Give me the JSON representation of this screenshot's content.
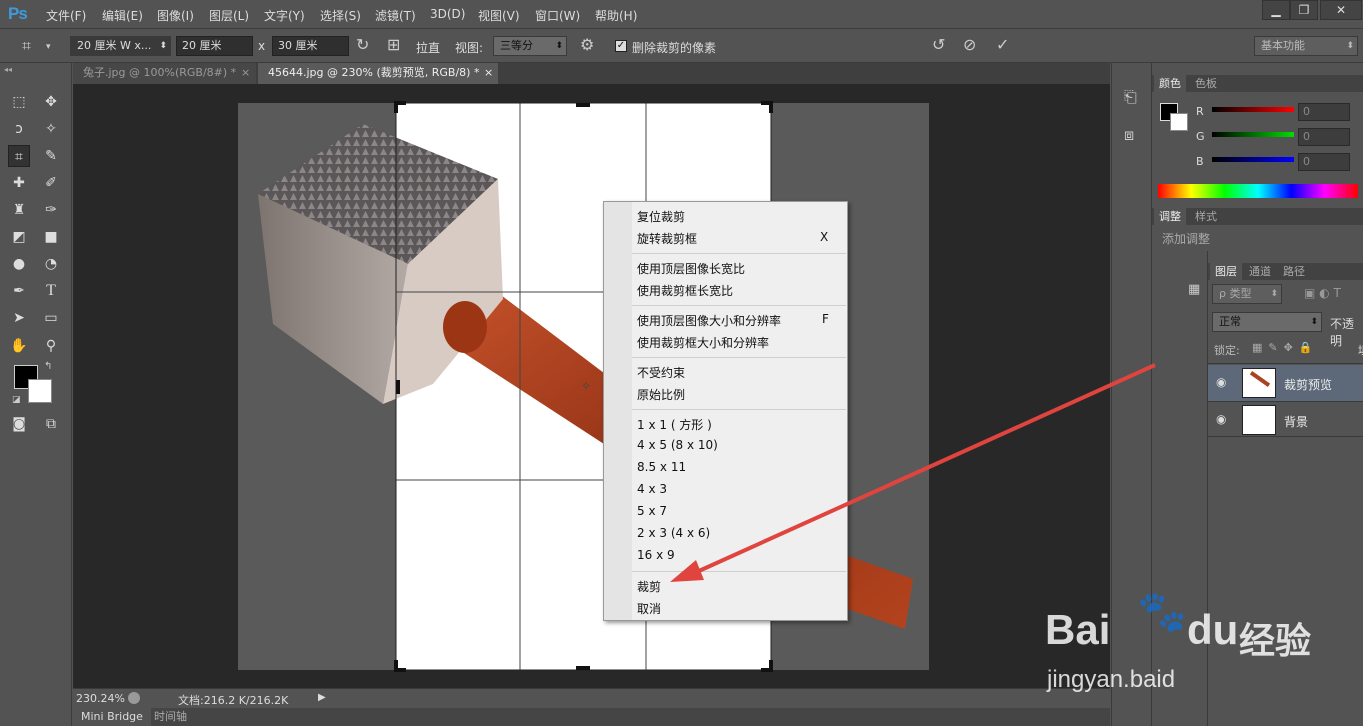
{
  "app": {
    "logo": "Ps",
    "window_buttons": [
      "▁",
      "❐",
      "✕"
    ]
  },
  "menubar": [
    "文件(F)",
    "编辑(E)",
    "图像(I)",
    "图层(L)",
    "文字(Y)",
    "选择(S)",
    "滤镜(T)",
    "3D(D)",
    "视图(V)",
    "窗口(W)",
    "帮助(H)"
  ],
  "options": {
    "preset": "20 厘米 W x...",
    "width": "20 厘米",
    "x_sep": "x",
    "height": "30 厘米",
    "straighten": "拉直",
    "view_label": "视图:",
    "view_value": "三等分",
    "delete_pixels": "删除裁剪的像素",
    "workspace": "基本功能"
  },
  "tabs": [
    {
      "label": "兔子.jpg @ 100%(RGB/8#) *",
      "close": "×"
    },
    {
      "label": "45644.jpg @ 230% (裁剪预览, RGB/8) *",
      "close": "×"
    }
  ],
  "context_menu": {
    "items": [
      {
        "label": "复位裁剪",
        "shortcut": ""
      },
      {
        "label": "旋转裁剪框",
        "shortcut": "X"
      },
      {
        "label": "使用顶层图像长宽比",
        "shortcut": ""
      },
      {
        "label": "使用裁剪框长宽比",
        "shortcut": ""
      },
      {
        "label": "使用顶层图像大小和分辨率",
        "shortcut": "F"
      },
      {
        "label": "使用裁剪框大小和分辨率",
        "shortcut": ""
      },
      {
        "label": "不受约束",
        "shortcut": ""
      },
      {
        "label": "原始比例",
        "shortcut": ""
      },
      {
        "label": "1 x 1 ( 方形 )",
        "shortcut": ""
      },
      {
        "label": "4 x 5 (8 x 10)",
        "shortcut": ""
      },
      {
        "label": "8.5 x 11",
        "shortcut": ""
      },
      {
        "label": "4 x 3",
        "shortcut": ""
      },
      {
        "label": "5 x 7",
        "shortcut": ""
      },
      {
        "label": "2 x 3 (4 x 6)",
        "shortcut": ""
      },
      {
        "label": "16 x 9",
        "shortcut": ""
      },
      {
        "label": "裁剪",
        "shortcut": ""
      },
      {
        "label": "取消",
        "shortcut": ""
      }
    ]
  },
  "status": {
    "zoom": "230.24%",
    "doc": "文档:216.2 K/216.2K",
    "arrow": "▶"
  },
  "bottom_tabs": [
    "Mini Bridge",
    "时间轴"
  ],
  "color_panel": {
    "tabs": [
      "颜色",
      "色板"
    ],
    "channels": [
      {
        "label": "R",
        "value": "0"
      },
      {
        "label": "G",
        "value": "0"
      },
      {
        "label": "B",
        "value": "0"
      }
    ]
  },
  "adjust_panel": {
    "tabs": [
      "调整",
      "样式"
    ],
    "add_label": "添加调整"
  },
  "layers_panel": {
    "tabs": [
      "图层",
      "通道",
      "路径"
    ],
    "filter": "ρ 类型",
    "blend_mode": "正常",
    "opacity_label": "不透明",
    "lock_label": "锁定:",
    "fill_label": "填",
    "layers": [
      {
        "name": "裁剪预览",
        "selected": true
      },
      {
        "name": "背景",
        "selected": false
      }
    ]
  },
  "watermark": {
    "brand": "Bai",
    "brand2": "du",
    "suffix": "经验",
    "url": "jingyan.baid"
  },
  "colors": {
    "accent": "#3d9bdc",
    "handle": "#a8441f",
    "arrow": "#e0443f"
  }
}
